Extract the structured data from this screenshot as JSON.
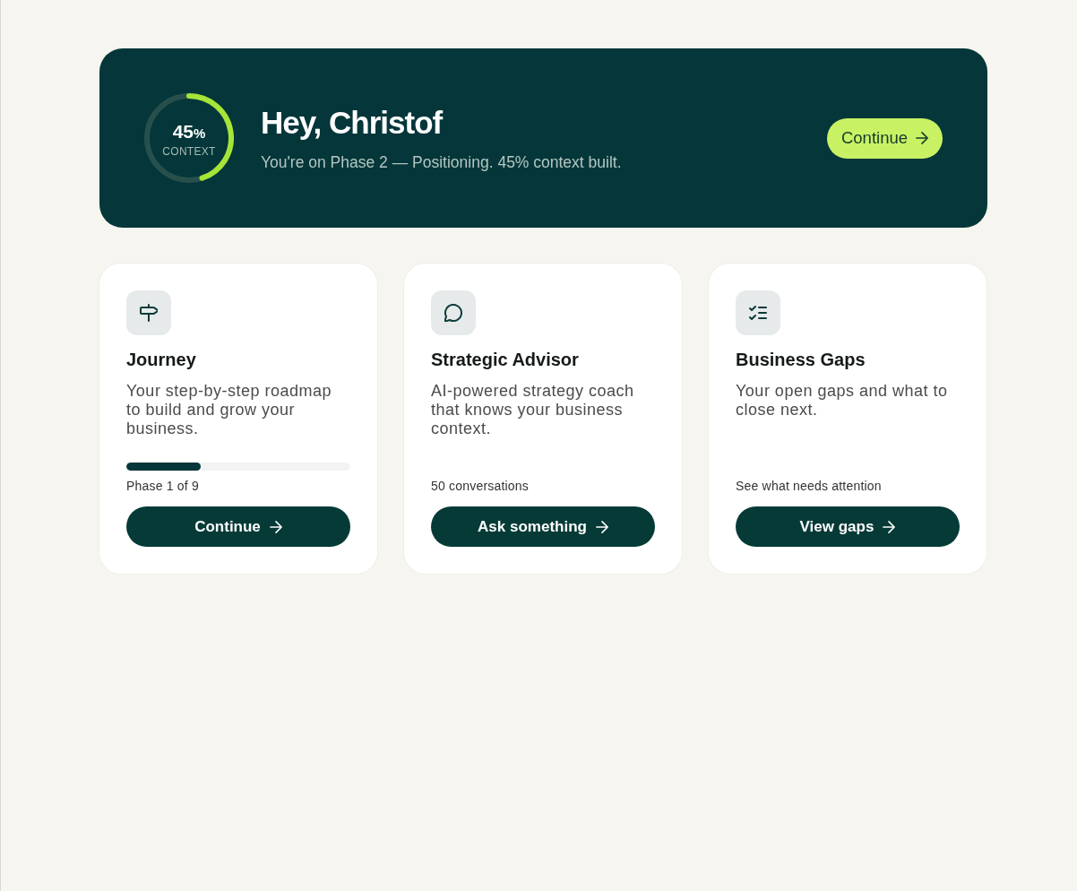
{
  "hero": {
    "ring": {
      "value": "45",
      "unit": "%",
      "label": "CONTEXT",
      "level": 0.45
    },
    "title": "Hey, Christof",
    "subtitle": "You're on Phase 2 — Positioning. 45% context built.",
    "button": "Continue"
  },
  "cards": [
    {
      "kind": "roadmap",
      "title": "Journey",
      "description": "Your step-by-step roadmap to build and grow your business.",
      "progress": {
        "level": 0.33
      },
      "meta": "Phase 1 of 9",
      "button": "Continue"
    },
    {
      "kind": "advisor",
      "title": "Strategic Advisor",
      "description": "AI-powered strategy coach that knows your business context.",
      "meta": "50 conversations",
      "button": "Ask something"
    },
    {
      "kind": "gaps",
      "title": "Business Gaps",
      "description": "Your open gaps and what to close next.",
      "meta": "See what needs attention",
      "button": "View gaps"
    }
  ]
}
